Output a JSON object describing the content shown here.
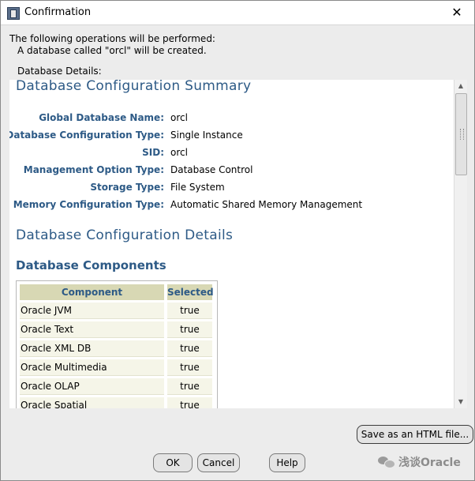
{
  "window": {
    "title": "Confirmation"
  },
  "intro": {
    "line1": "The following operations will be performed:",
    "line2": "A database called \"orcl\" will be created."
  },
  "details_label": "Database Details:",
  "summary": {
    "title": "Database Configuration Summary",
    "rows": [
      {
        "label": "Global Database Name:",
        "value": "orcl"
      },
      {
        "label": "Database Configuration Type:",
        "value": "Single Instance"
      },
      {
        "label": "SID:",
        "value": "orcl"
      },
      {
        "label": "Management Option Type:",
        "value": "Database Control"
      },
      {
        "label": "Storage Type:",
        "value": "File System"
      },
      {
        "label": "Memory Configuration Type:",
        "value": "Automatic Shared Memory Management"
      }
    ]
  },
  "details_title": "Database Configuration Details",
  "components": {
    "title": "Database Components",
    "headers": {
      "component": "Component",
      "selected": "Selected"
    },
    "rows": [
      {
        "name": "Oracle JVM",
        "selected": "true"
      },
      {
        "name": "Oracle Text",
        "selected": "true"
      },
      {
        "name": "Oracle XML DB",
        "selected": "true"
      },
      {
        "name": "Oracle Multimedia",
        "selected": "true"
      },
      {
        "name": "Oracle OLAP",
        "selected": "true"
      },
      {
        "name": "Oracle Spatial",
        "selected": "true"
      }
    ]
  },
  "buttons": {
    "save_html": "Save as an HTML file...",
    "ok": "OK",
    "cancel": "Cancel",
    "help": "Help"
  },
  "watermark": {
    "text": "浅谈Oracle"
  },
  "icons": {
    "app": "app-window-icon",
    "close": "close-icon",
    "scroll_up": "scroll-up-arrow-icon",
    "scroll_down": "scroll-down-arrow-icon",
    "watermark": "wechat-icon"
  }
}
